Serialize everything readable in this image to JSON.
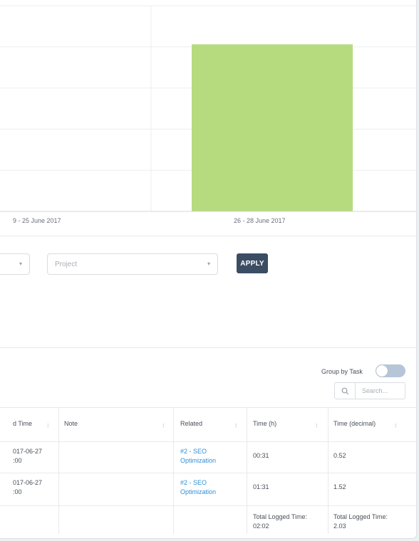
{
  "chart_data": {
    "type": "bar",
    "categories": [
      "9 - 25 June 2017",
      "26 - 28 June 2017"
    ],
    "values": [
      0,
      2.03
    ],
    "ylim": [
      0,
      2.5
    ],
    "grid": true,
    "bar_color": "#b5db7e"
  },
  "filters": {
    "project_placeholder": "Project",
    "apply_label": "APPLY"
  },
  "table_controls": {
    "group_by_label": "Group by Task",
    "group_by_on": false,
    "search_placeholder": "Search..."
  },
  "table": {
    "headers": {
      "start": "d Time",
      "note": "Note",
      "related": "Related",
      "time_h": "Time (h)",
      "time_dec": "Time (decimal)"
    },
    "rows": [
      {
        "date": "017-06-27",
        "time": ":00",
        "related": "#2 - SEO Optimization",
        "time_h": "00:31",
        "time_dec": "0.52"
      },
      {
        "date": "017-06-27",
        "time": ":00",
        "related": "#2 - SEO Optimization",
        "time_h": "01:31",
        "time_dec": "1.52"
      }
    ],
    "totals": {
      "label_h": "Total Logged Time:",
      "value_h": "02:02",
      "label_dec": "Total Logged Time:",
      "value_dec": "2.03"
    }
  }
}
